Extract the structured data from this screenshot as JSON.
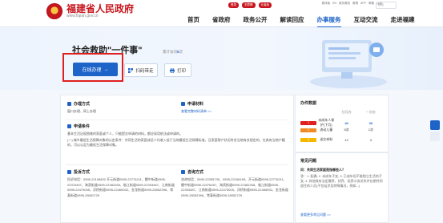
{
  "header": {
    "brand_title": "福建省人民政府",
    "brand_url": "www.fujian.gov.cn",
    "pills": [
      "登录",
      "无障碍",
      "长者版"
    ],
    "top_links": [
      "繁体版",
      "EN",
      "政务微信",
      "微博",
      "APP",
      "邮箱",
      "注册"
    ],
    "search_placeholder": "搜索",
    "nav": [
      {
        "label": "首页",
        "active": false
      },
      {
        "label": "省政府",
        "active": false
      },
      {
        "label": "政务公开",
        "active": false
      },
      {
        "label": "解读回应",
        "active": false
      },
      {
        "label": "办事服务",
        "active": true
      },
      {
        "label": "互动交流",
        "active": false
      },
      {
        "label": "走进福建",
        "active": false
      }
    ]
  },
  "hero": {
    "title": "社会救助\"一件事\"",
    "visits_prefix": "累计访问",
    "visits_count": "5",
    "visits_suffix": "次",
    "apply_label": "在线办理",
    "apply_arrow": "→",
    "scan_label": "扫码带走",
    "print_label": "打印"
  },
  "sections": {
    "handle_method": {
      "title": "办理方式",
      "text": "窗口办理、网上办理"
    },
    "apply_materials": {
      "title": "申请材料",
      "link": "查看完整材料清单 >>"
    },
    "conditions": {
      "title": "申请条件",
      "line1": "基本生活出现困难的家庭或个人，只能提交申请的材料，都应采用依法或申请的。",
      "line2": "(一) 城乡最低生活保障对象的认定条件：共同生活的家庭成员人均收入低于当地最低生活保障标准，且家庭财产状况符合当地有关规定的，在具有当地户籍的，可以认定为最低生活保障对象。"
    },
    "complaint": {
      "title": "投诉方式",
      "text": "投诉电话：0595-22198822 开元街道0595-22776211、鲤中街道0595-22376457、海滨街道0595-22382268、临江街道0595-22393487、江南街道0595-22473005、浮桥街道0595-22465932、金龙街道0595-28052396、常泰街道0595-28052729"
    },
    "consult": {
      "title": "咨询方式",
      "text": "咨询电话：0595-22355739、0595-22158165、开元街道0595-22776211、鲤中街道0595-22376457、海滨街道0595-22382268、临江街道0595-22393487、江南街道0595-22473005、浮桥街道0595-22465932、金龙街道0595-28052396、常泰街道0595-28052729"
    }
  },
  "ranking": {
    "title": "办件数据",
    "headers": [
      "",
      "分月办",
      "一次办"
    ],
    "rows": [
      {
        "rank": "1",
        "name": "未成年人保护(下月)",
        "a": "40",
        "b": "30",
        "a_trend": "up",
        "b_trend": "up"
      },
      {
        "rank": "2",
        "name": "流动儿童",
        "a": "5次",
        "b": "1次",
        "a_trend": "",
        "b_trend": ""
      },
      {
        "rank": "3",
        "name": "送交材料",
        "a": "12",
        "b": "4",
        "a_trend": "",
        "b_trend": "down"
      }
    ],
    "colors": {
      "rank1": "#e02020",
      "rank2": "#f08a24",
      "rank3": "#f5b800"
    }
  },
  "faq": {
    "title": "常见问题",
    "question": "问：共同生活家庭是指哪些人？",
    "answer": "答：1. 配偶; 2. 未成年子女; 3. 已成年但不能独立生活的子女; 4. 其他具有法定赡养、扶养、抚养义务关系并长期共同居住的人员(不包括涉及特殊情况，例如...)",
    "more": "查看更多常见问题 >>"
  },
  "colors": {
    "accent": "#1d63c8",
    "brand_red": "#c8161e",
    "highlight": "#e02020"
  }
}
